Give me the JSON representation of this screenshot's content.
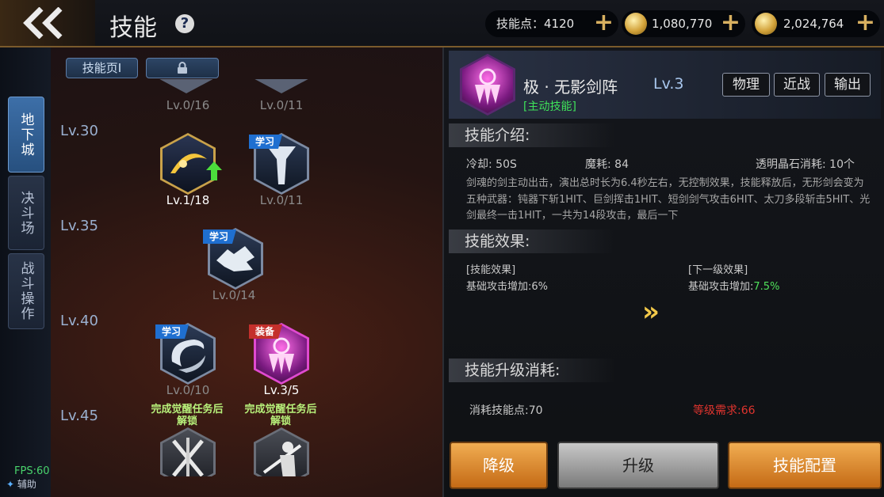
{
  "header": {
    "title": "技能",
    "help_label": "?",
    "skill_points": "技能点：4120",
    "gold_amount": "1,080,770",
    "bound_gold_amount": "2,024,764",
    "plus_label": "+",
    "icons": [
      "back-chevron-icon",
      "help-icon",
      "gold-coin-icon",
      "locked-gold-coin-icon",
      "plus-icon"
    ]
  },
  "side_nav": {
    "tabs": [
      {
        "label": "地下城",
        "active": true
      },
      {
        "label": "决斗场",
        "active": false
      },
      {
        "label": "战斗操作",
        "active": false
      }
    ]
  },
  "skill_pages": {
    "page1_label": "技能页Ⅰ",
    "page2_locked": true
  },
  "skill_tree": {
    "level_rows": [
      "Lv.30",
      "Lv.35",
      "Lv.40",
      "Lv.45"
    ],
    "top_partial": [
      {
        "level_text": "Lv.0/16"
      },
      {
        "level_text": "Lv.0/11"
      }
    ],
    "skills": [
      {
        "row": "Lv.30",
        "level_text": "Lv.1/18",
        "badge": "",
        "upgradeable": true,
        "learned": true
      },
      {
        "row": "Lv.30",
        "level_text": "Lv.0/11",
        "badge": "学习",
        "learned": false
      },
      {
        "row": "Lv.35",
        "level_text": "Lv.0/14",
        "badge": "学习",
        "learned": false
      },
      {
        "row": "Lv.40",
        "level_text": "Lv.0/10",
        "badge": "学习",
        "learned": false
      },
      {
        "row": "Lv.40",
        "level_text": "Lv.3/5",
        "badge": "装备",
        "learned": true,
        "selected": true
      },
      {
        "row": "Lv.45",
        "locked_text": "完成觉醒任务后解锁",
        "locked": true
      },
      {
        "row": "Lv.45",
        "locked_text": "完成觉醒任务后解锁",
        "locked": true
      }
    ]
  },
  "status": {
    "fps": "FPS:60",
    "assist": "辅助"
  },
  "detail": {
    "name": "极 · 无影剑阵",
    "level": "Lv.3",
    "type": "[主动技能]",
    "tags": [
      "物理",
      "近战",
      "输出"
    ],
    "intro_title": "技能介绍:",
    "cooldown": "冷却: 50S",
    "mp_cost": "魔耗: 84",
    "crystal_cost": "透明晶石消耗: 10个",
    "description": "剑魂的剑主动出击，演出总时长为6.4秒左右，无控制效果，技能释放后，无形剑会变为五种武器：钝器下斩1HIT、巨剑挥击1HIT、短剑剑气攻击6HIT、太刀多段斩击5HIT、光剑最终一击1HIT，一共为14段攻击，最后一下",
    "effect_title": "技能效果:",
    "current_effect_header": "[技能效果]",
    "current_effect_label": "基础攻击增加:",
    "current_effect_value": "6%",
    "next_effect_header": "[下一级效果]",
    "next_effect_label": "基础攻击增加:",
    "next_effect_value": "7.5%",
    "arrow": "»",
    "cost_title": "技能升级消耗:",
    "cost_points": "消耗技能点:70",
    "level_requirement": "等级需求:66"
  },
  "actions": {
    "downgrade": "降级",
    "upgrade": "升级",
    "config": "技能配置"
  },
  "colors": {
    "accent_orange": "#e08a2c",
    "requirement_red": "#e0342e",
    "active_green": "#3fe25a",
    "next_value_green": "#4fe05a"
  }
}
